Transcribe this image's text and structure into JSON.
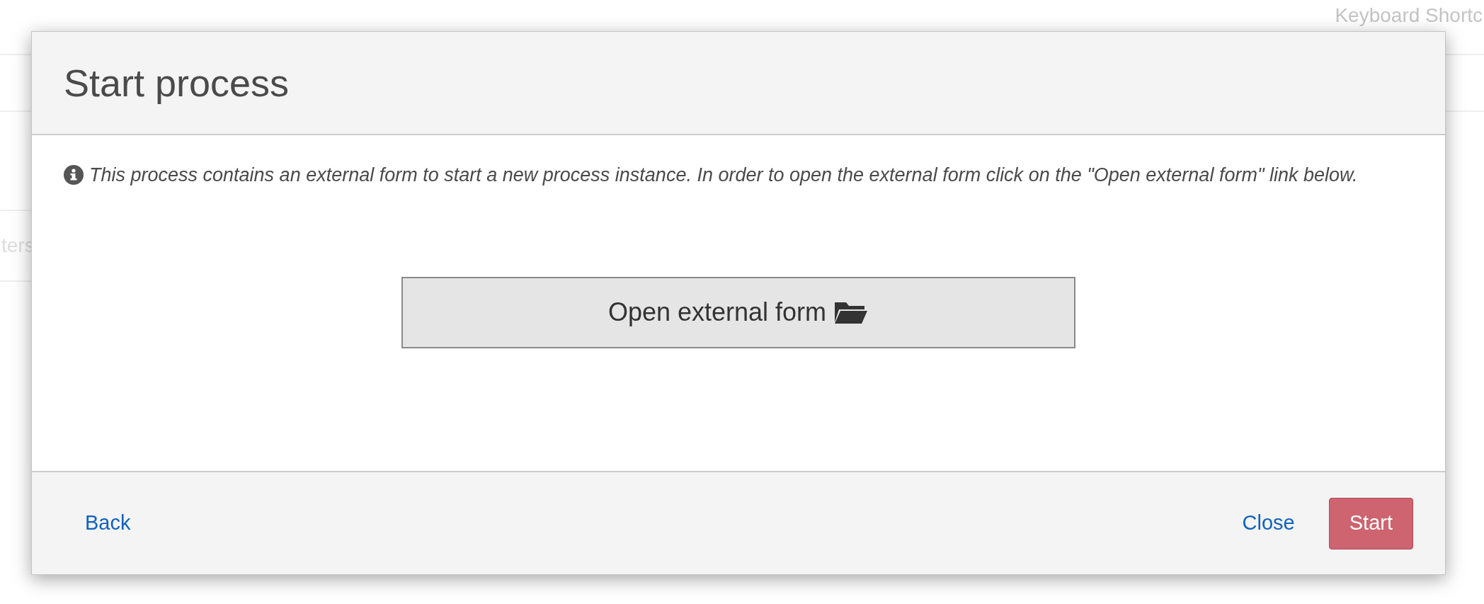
{
  "background": {
    "header_link": "Keyboard Shortc",
    "side_text": "ters"
  },
  "dialog": {
    "title": "Start process",
    "info": "This process contains an external form to start a new process instance. In order to open the external form click on the \"Open external form\" link below.",
    "open_button": "Open external form",
    "footer": {
      "back": "Back",
      "close": "Close",
      "start": {
        "label": "Start",
        "disabled": true
      }
    }
  }
}
